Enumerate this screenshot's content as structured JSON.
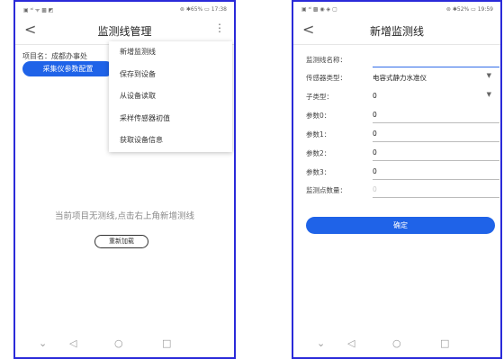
{
  "left": {
    "status": {
      "left": "▣ ᵃˡ ᯤ ▩ ◩",
      "right": "⊚ ✱65% ▭ 17:38"
    },
    "header": {
      "back": "<",
      "title": "监测线管理",
      "more": "⋮"
    },
    "project_label": "项目名：成都办事处",
    "config_button": "采集仪参数配置",
    "menu": [
      "新增监测线",
      "保存到设备",
      "从设备读取",
      "采样传感器初值",
      "获取设备信息"
    ],
    "empty_message": "当前项目无测线,点击右上角新增测线",
    "reload_button": "重新加载",
    "nav": {
      "down": "⌄",
      "back": "◁",
      "home": "○",
      "recent": "□"
    }
  },
  "right": {
    "status": {
      "left": "▣ ᵃˡ ▩ ◉ ◈ ▢",
      "right": "⊚ ✱52% ▭ 19:59"
    },
    "header": {
      "back": "<",
      "title": "新增监测线"
    },
    "form": {
      "name_label": "监测线名称：",
      "sensor_label": "传感器类型：",
      "sensor_value": "电容式静力水准仪",
      "subtype_label": "子类型：",
      "subtype_value": "0",
      "param0_label": "参数0：",
      "param0_value": "0",
      "param1_label": "参数1：",
      "param1_value": "0",
      "param2_label": "参数2：",
      "param2_value": "0",
      "param3_label": "参数3：",
      "param3_value": "0",
      "points_label": "监测点数量：",
      "points_placeholder": "0"
    },
    "confirm_button": "确定",
    "nav": {
      "down": "⌄",
      "back": "◁",
      "home": "○",
      "recent": "□"
    }
  },
  "colors": {
    "accent": "#1f63e8",
    "frame": "#2a2ad9"
  },
  "icons": [
    "back-icon",
    "more-icon",
    "dropdown-icon",
    "nav-back-icon",
    "nav-home-icon",
    "nav-recent-icon"
  ]
}
